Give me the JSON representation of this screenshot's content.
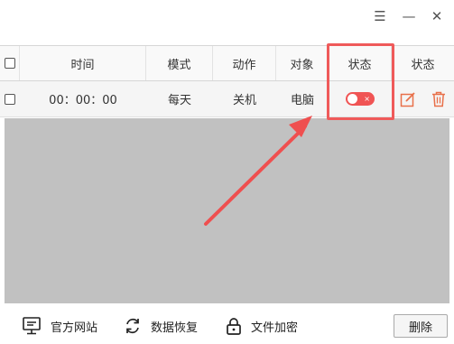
{
  "window_controls": {
    "menu_icon": "☰",
    "minimize_icon": "—",
    "close_icon": "✕"
  },
  "table": {
    "headers": {
      "time": "时间",
      "mode": "模式",
      "action": "动作",
      "target": "对象",
      "status": "状态",
      "status2": "状态"
    },
    "rows": [
      {
        "time": "00：00：00",
        "mode": "每天",
        "action": "关机",
        "target": "电脑",
        "status_on": false,
        "toggle_mark": "×"
      }
    ]
  },
  "bottom_bar": {
    "official_site": "官方网站",
    "data_restore": "数据恢复",
    "file_encrypt": "文件加密",
    "delete": "删除"
  },
  "colors": {
    "accent": "#ef5a5a",
    "toggle_off": "#f05454",
    "edit_icon": "#e8704a",
    "delete_icon": "#e8704a",
    "list_bg": "#c1c1c1"
  },
  "icons": {
    "site": "monitor-icon",
    "restore": "refresh-icon",
    "encrypt": "lock-icon",
    "edit": "edit-icon",
    "trash": "trash-icon"
  }
}
